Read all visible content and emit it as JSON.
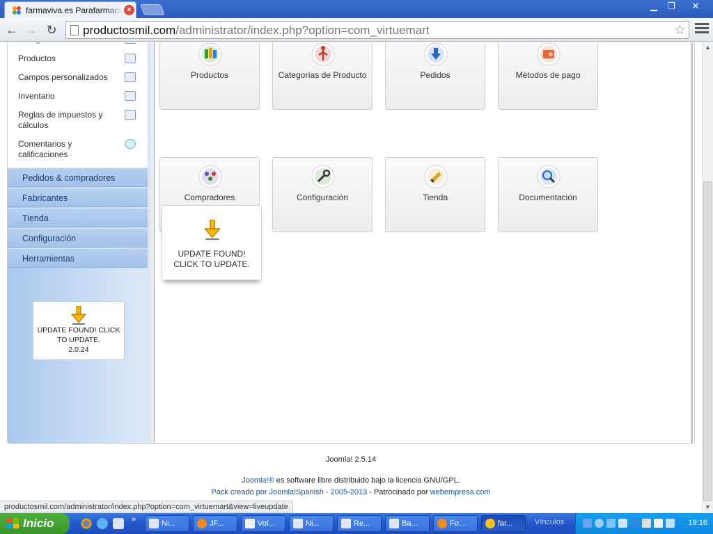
{
  "browser": {
    "tab_title": "farmaviva.es Parafarmacia o",
    "url_host": "productosmil.com",
    "url_path": "/administrator/index.php?option=com_virtuemart"
  },
  "sidebar": {
    "sub_items": [
      {
        "label": "Categorías de Producto",
        "icon": "folder-icon"
      },
      {
        "label": "Productos",
        "icon": "camera-icon"
      },
      {
        "label": "Campos personalizados",
        "icon": "fields-icon"
      },
      {
        "label": "Inventario",
        "icon": "chart-icon"
      },
      {
        "label": "Reglas de impuestos y cálculos",
        "icon": "calculator-icon"
      },
      {
        "label": "Comentarios y calificaciones",
        "icon": "speech-bubble-icon"
      }
    ],
    "menus": [
      "Pedidos & compradores",
      "Fabricantes",
      "Tienda",
      "Configuración",
      "Herramientas"
    ],
    "update": {
      "line1": "UPDATE FOUND! CLICK TO UPDATE.",
      "version": "2.0.24"
    }
  },
  "tiles": [
    {
      "label": "Productos",
      "icon": "products-icon",
      "color": "#2f8a2a"
    },
    {
      "label": "Categorías de Producto",
      "icon": "categories-icon",
      "color": "#b02a2a"
    },
    {
      "label": "Pedidos",
      "icon": "orders-icon",
      "color": "#2a62c9"
    },
    {
      "label": "Métodos de pago",
      "icon": "payment-icon",
      "color": "#d9532c"
    },
    {
      "label": "Compradores",
      "icon": "shoppers-icon",
      "color": "#5b4fa8"
    },
    {
      "label": "Configuración",
      "icon": "wrench-icon",
      "color": "#2f8a2a"
    },
    {
      "label": "Tienda",
      "icon": "pencil-icon",
      "color": "#e0a21c"
    },
    {
      "label": "Documentación",
      "icon": "magnifier-icon",
      "color": "#2a62c9"
    }
  ],
  "update_tile": {
    "label": "UPDATE FOUND! CLICK TO UPDATE."
  },
  "footer": {
    "version": "Joomla! 2.5.14",
    "license_link": "Joomla!®",
    "license_text": " es software libre distribuido bajo la licencia GNU/GPL.",
    "pack_prefix": "Pack creado por ",
    "pack_link": "Joomla!Spanish - 2005-2013",
    "sponsor_text": " - Patrocinado por ",
    "sponsor_link": "webempresa.com"
  },
  "status_url": "productosmil.com/administrator/index.php?option=com_virtuemart&view=liveupdate",
  "taskbar": {
    "start_label": "Inicio",
    "tasks": [
      {
        "label": "Ni...",
        "icon": "app-icon"
      },
      {
        "label": "JF...",
        "icon": "firefox-icon"
      },
      {
        "label": "Vol...",
        "icon": "doc-icon"
      },
      {
        "label": "Ni...",
        "icon": "app-icon"
      },
      {
        "label": "Re...",
        "icon": "app-icon"
      },
      {
        "label": "Ba...",
        "icon": "app-icon"
      },
      {
        "label": "Fo...",
        "icon": "firefox-icon"
      },
      {
        "label": "far...",
        "icon": "chrome-icon"
      }
    ],
    "links_label": "Vínculos",
    "clock": "19:16"
  }
}
